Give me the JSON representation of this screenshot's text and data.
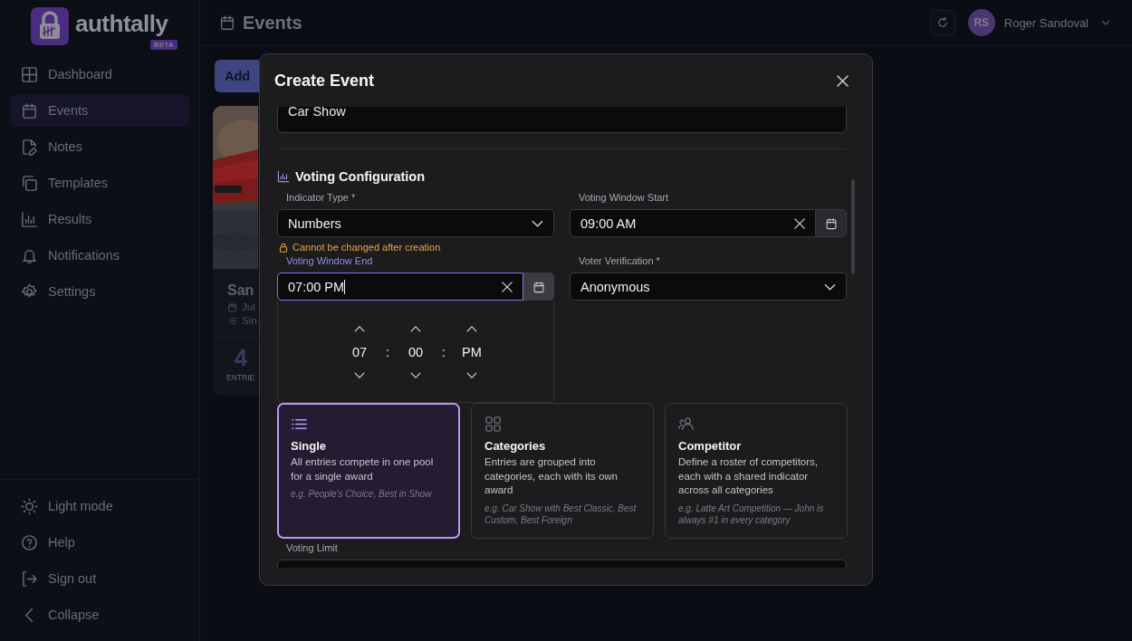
{
  "app": {
    "logo_text": "authtally",
    "badge": "BETA"
  },
  "sidebar": {
    "items": [
      {
        "label": "Dashboard",
        "selected": false
      },
      {
        "label": "Events",
        "selected": true
      },
      {
        "label": "Notes",
        "selected": false
      },
      {
        "label": "Templates",
        "selected": false
      },
      {
        "label": "Results",
        "selected": false
      },
      {
        "label": "Notifications",
        "selected": false
      },
      {
        "label": "Settings",
        "selected": false
      }
    ],
    "footer_items": [
      {
        "label": "Light mode"
      },
      {
        "label": "Help"
      },
      {
        "label": "Sign out"
      },
      {
        "label": "Collapse"
      }
    ]
  },
  "header": {
    "title": "Events",
    "user": {
      "initials": "RS",
      "name": "Roger Sandoval"
    }
  },
  "page": {
    "add_button": "Add",
    "event_card": {
      "kind": "picture",
      "title": "San",
      "date": "Jul",
      "type": "Sin",
      "count": "4",
      "count_label": "ENTRIE"
    }
  },
  "modal": {
    "title": "Create Event",
    "name_field": {
      "value": "Car Show"
    },
    "section_title": "Voting Configuration",
    "indicator_type": {
      "label": "Indicator Type *",
      "value": "Numbers",
      "note": "Cannot be changed after creation"
    },
    "window_start": {
      "label": "Voting Window Start",
      "value": "09:00 AM"
    },
    "window_end": {
      "label": "Voting Window End",
      "value": "07:00 PM",
      "focused": true
    },
    "voter_verification": {
      "label": "Voter Verification *",
      "value": "Anonymous"
    },
    "time_picker": {
      "hour": "07",
      "minute": "00",
      "period": "PM",
      "separator": ":"
    },
    "voting_types": [
      {
        "title": "Single",
        "description": "All entries compete in one pool for a single award",
        "example": "e.g. People's Choice, Best in Show",
        "selected": true
      },
      {
        "title": "Categories",
        "description": "Entries are grouped into categories, each with its own award",
        "example": "e.g. Car Show with Best Classic, Best Custom, Best Foreign",
        "selected": false
      },
      {
        "title": "Competitor",
        "description": "Define a roster of competitors, each with a shared indicator across all categories",
        "example": "e.g. Latte Art Competition — John is always #1 in every category",
        "selected": false
      }
    ],
    "voting_limit": {
      "label": "Voting Limit"
    }
  }
}
